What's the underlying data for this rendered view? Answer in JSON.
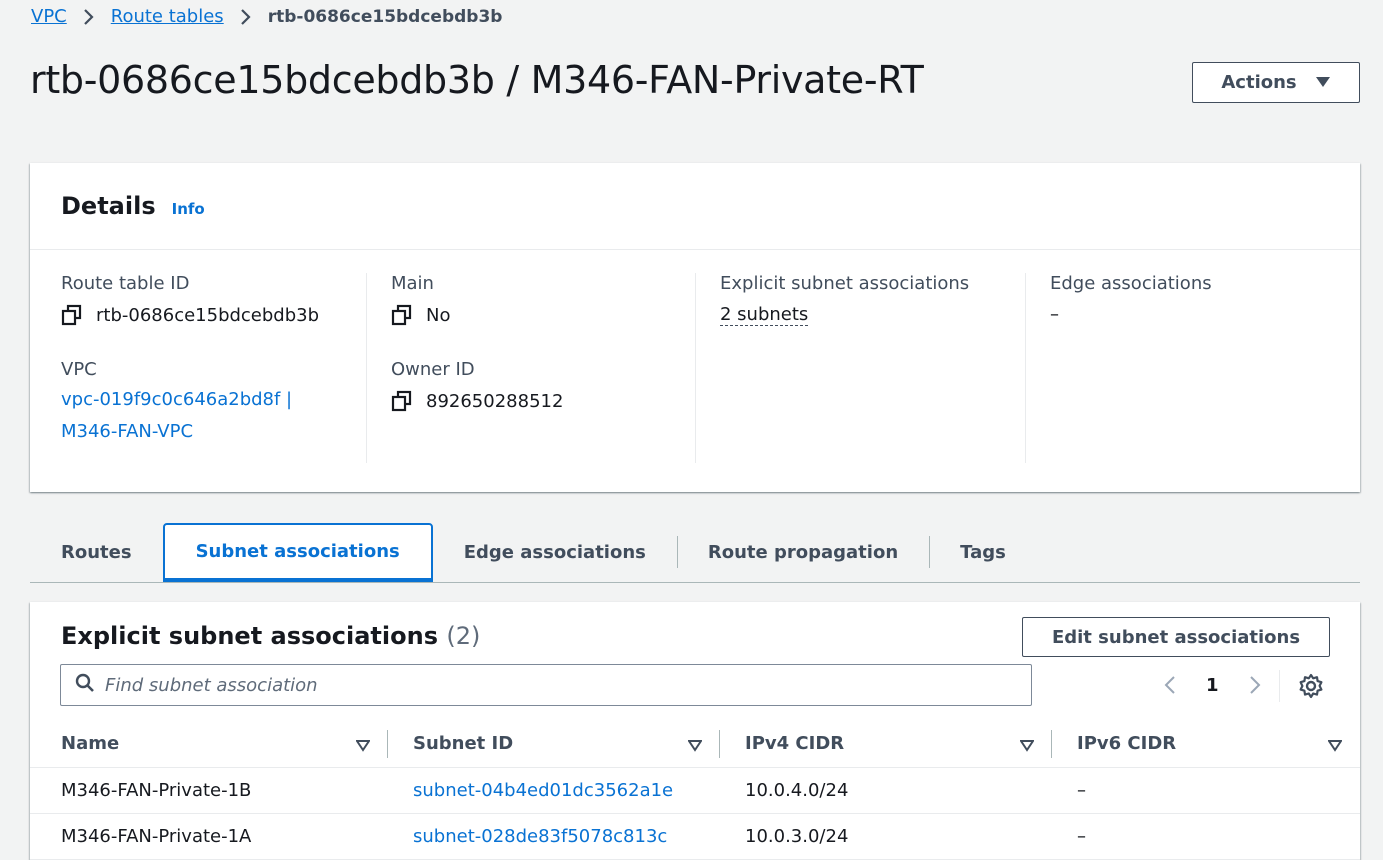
{
  "breadcrumb": {
    "items": [
      "VPC",
      "Route tables"
    ],
    "current": "rtb-0686ce15bdcebdb3b"
  },
  "page": {
    "title": "rtb-0686ce15bdcebdb3b / M346-FAN-Private-RT",
    "actions_label": "Actions"
  },
  "details": {
    "title": "Details",
    "info_label": "Info",
    "route_table_id_label": "Route table ID",
    "route_table_id": "rtb-0686ce15bdcebdb3b",
    "vpc_label": "VPC",
    "vpc_line1": "vpc-019f9c0c646a2bd8f |",
    "vpc_line2": "M346-FAN-VPC",
    "main_label": "Main",
    "main_value": "No",
    "owner_id_label": "Owner ID",
    "owner_id": "892650288512",
    "explicit_label": "Explicit subnet associations",
    "explicit_value": "2 subnets",
    "edge_label": "Edge associations",
    "edge_value": "–"
  },
  "tabs": [
    {
      "label": "Routes",
      "active": false
    },
    {
      "label": "Subnet associations",
      "active": true
    },
    {
      "label": "Edge associations",
      "active": false
    },
    {
      "label": "Route propagation",
      "active": false
    },
    {
      "label": "Tags",
      "active": false
    }
  ],
  "associations": {
    "title": "Explicit subnet associations",
    "count": "(2)",
    "edit_label": "Edit subnet associations",
    "search_placeholder": "Find subnet association",
    "page": "1",
    "columns": [
      "Name",
      "Subnet ID",
      "IPv4 CIDR",
      "IPv6 CIDR"
    ],
    "rows": [
      {
        "name": "M346-FAN-Private-1B",
        "subnet_id": "subnet-04b4ed01dc3562a1e",
        "ipv4": "10.0.4.0/24",
        "ipv6": "–"
      },
      {
        "name": "M346-FAN-Private-1A",
        "subnet_id": "subnet-028de83f5078c813c",
        "ipv4": "10.0.3.0/24",
        "ipv6": "–"
      }
    ]
  },
  "colors": {
    "link": "#0972d3",
    "background": "#f2f3f3",
    "text": "#16191f",
    "secondary_text": "#414d5c"
  }
}
